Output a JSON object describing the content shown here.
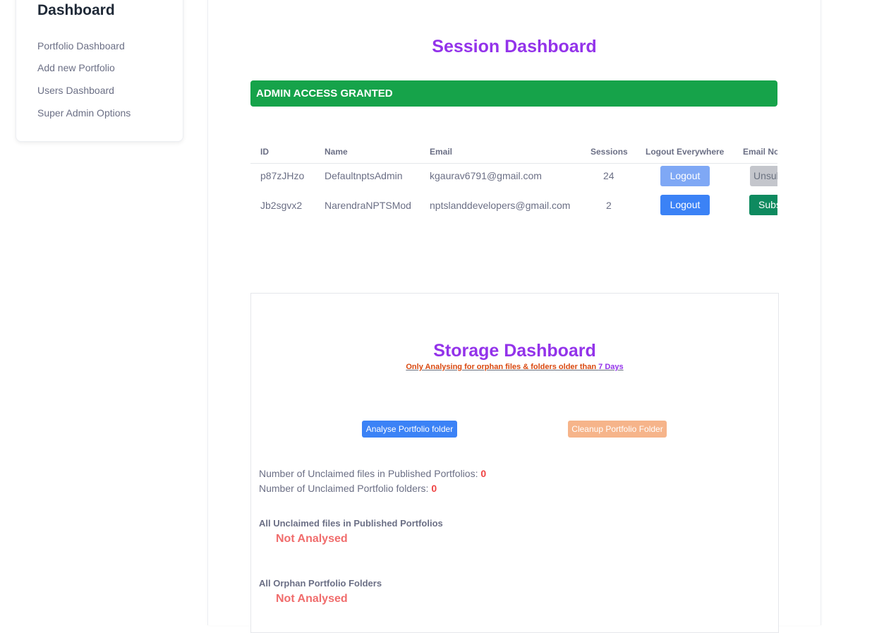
{
  "sidebar": {
    "title": "Dashboard",
    "items": [
      {
        "label": "Portfolio Dashboard"
      },
      {
        "label": "Add new Portfolio"
      },
      {
        "label": "Users Dashboard"
      },
      {
        "label": "Super Admin Options"
      }
    ]
  },
  "session": {
    "title": "Session Dashboard",
    "banner": "ADMIN ACCESS GRANTED",
    "columns": [
      "ID",
      "Name",
      "Email",
      "Sessions",
      "Logout Everywhere",
      "Email No"
    ],
    "rows": [
      {
        "id": "p87zJHzo",
        "name": "DefaultnptsAdmin",
        "email": "kgaurav6791@gmail.com",
        "sessions": "24",
        "logout": "Logout",
        "email_action": "Unsubscribe"
      },
      {
        "id": "Jb2sgvx2",
        "name": "NarendraNPTSMod",
        "email": "nptslanddevelopers@gmail.com",
        "sessions": "2",
        "logout": "Logout",
        "email_action": "Subscribe"
      }
    ],
    "colors": {
      "banner": "#16a34a",
      "logout_disabled": "#7fa8f5",
      "logout": "#3b82f6",
      "unsubscribe": "#c4c6cc",
      "subscribe": "#0e8a5f"
    }
  },
  "storage": {
    "title": "Storage Dashboard",
    "note_part1": "Only Analysing for orphan files & folders older than ",
    "note_part2": "7 Days",
    "analyse_button": "Analyse Portfolio folder",
    "cleanup_button": "Cleanup Portfolio Folder",
    "unclaimed_files_label": "Number of Unclaimed files in Published Portfolios: ",
    "unclaimed_files_count": "0",
    "unclaimed_folders_label": "Number of Unclaimed Portfolio folders: ",
    "unclaimed_folders_count": "0",
    "section1_title": "All Unclaimed files in Published Portfolios",
    "section1_status": "Not Analysed",
    "section2_title": "All Orphan Portfolio Folders",
    "section2_status": "Not Analysed",
    "colors": {
      "title": "#9333ea",
      "note": "#d9480f",
      "note_days": "#9333ea",
      "analyse": "#3b82f6",
      "cleanup": "#f6b48a",
      "count": "#ef4444"
    }
  }
}
